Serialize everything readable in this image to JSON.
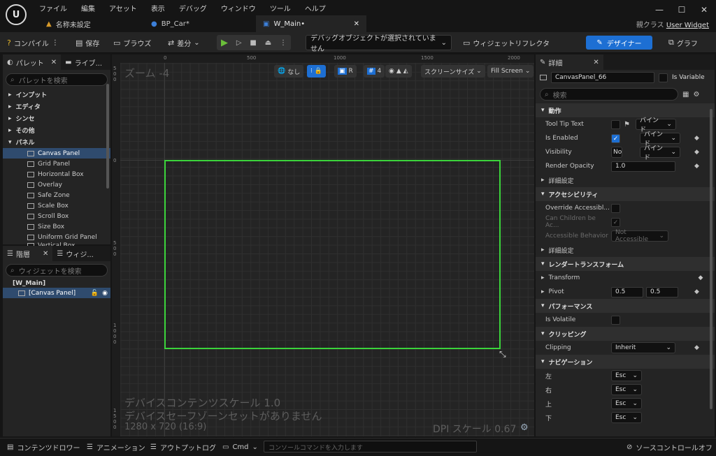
{
  "menu": [
    "ファイル",
    "編集",
    "アセット",
    "表示",
    "デバッグ",
    "ウィンドウ",
    "ツール",
    "ヘルプ"
  ],
  "logo_text": "U",
  "tabs": [
    {
      "label": "名称未設定"
    },
    {
      "label": "BP_Car*"
    },
    {
      "label": "W_Main•"
    }
  ],
  "parent_class": {
    "label": "親クラス",
    "value": "User Widget"
  },
  "toolbar": {
    "compile": "コンパイル",
    "save": "保存",
    "browse": "ブラウズ",
    "diff": "差分",
    "debug_select": "デバッグオブジェクトが選択されていません",
    "reflector": "ウィジェットリフレクタ",
    "designer": "デザイナー",
    "graph": "グラフ"
  },
  "palette": {
    "tab1": "パレット",
    "tab2": "ライブ...",
    "search_placeholder": "パレットを検索",
    "categories": [
      "インプット",
      "エディタ",
      "シンセ",
      "その他",
      "パネル"
    ],
    "panel_items": [
      "Canvas Panel",
      "Grid Panel",
      "Horizontal Box",
      "Overlay",
      "Safe Zone",
      "Scale Box",
      "Scroll Box",
      "Size Box",
      "Uniform Grid Panel",
      "Vertical Box"
    ]
  },
  "hierarchy": {
    "tab1": "階層",
    "tab2": "ウィジ...",
    "search_placeholder": "ウィジェットを検索",
    "root": "[W_Main]",
    "child": "[Canvas Panel]"
  },
  "canvas": {
    "zoom": "ズーム -4",
    "none": "なし",
    "r": "R",
    "grid_num": "4",
    "screen_size": "スクリーンサイズ",
    "fill_screen": "Fill Screen",
    "ruler_h": [
      "0",
      "500",
      "1000",
      "1500",
      "2000"
    ],
    "ruler_v": [
      "500",
      "0",
      "500",
      "1000",
      "1500"
    ],
    "overlay_line1": "デバイスコンテンツスケール 1.0",
    "overlay_line2": "デバイスセーフゾーンセットがありません",
    "resolution": "1280 x 720 (16:9)",
    "dpi": "DPI スケール 0.67"
  },
  "details": {
    "tab": "詳細",
    "name": "CanvasPanel_66",
    "is_variable": "Is Variable",
    "search_placeholder": "検索",
    "bind": "バインド",
    "sect_behavior": "動作",
    "tooltip": "Tool Tip Text",
    "is_enabled": "Is Enabled",
    "visibility": "Visibility",
    "visibility_val": "No",
    "render_opacity": "Render Opacity",
    "opacity_val": "1.0",
    "advanced": "詳細設定",
    "sect_access": "アクセシビリティ",
    "override_access": "Override Accessibl...",
    "can_children": "Can Children be Ac...",
    "access_behavior": "Accessible Behavior",
    "access_val": "Not Accessible",
    "sect_render": "レンダートランスフォーム",
    "transform": "Transform",
    "pivot": "Pivot",
    "pivot_x": "0.5",
    "pivot_y": "0.5",
    "sect_perf": "パフォーマンス",
    "is_volatile": "Is Volatile",
    "sect_clip": "クリッピング",
    "clipping": "Clipping",
    "clip_val": "Inherit",
    "sect_nav": "ナビゲーション",
    "nav": [
      {
        "label": "左",
        "val": "Esc"
      },
      {
        "label": "右",
        "val": "Esc"
      },
      {
        "label": "上",
        "val": "Esc"
      },
      {
        "label": "下",
        "val": "Esc"
      }
    ]
  },
  "status": {
    "content_drawer": "コンテンツドロワー",
    "animation": "アニメーション",
    "output_log": "アウトプットログ",
    "cmd": "Cmd",
    "console_placeholder": "コンソールコマンドを入力します",
    "source_control": "ソースコントロールオフ"
  }
}
